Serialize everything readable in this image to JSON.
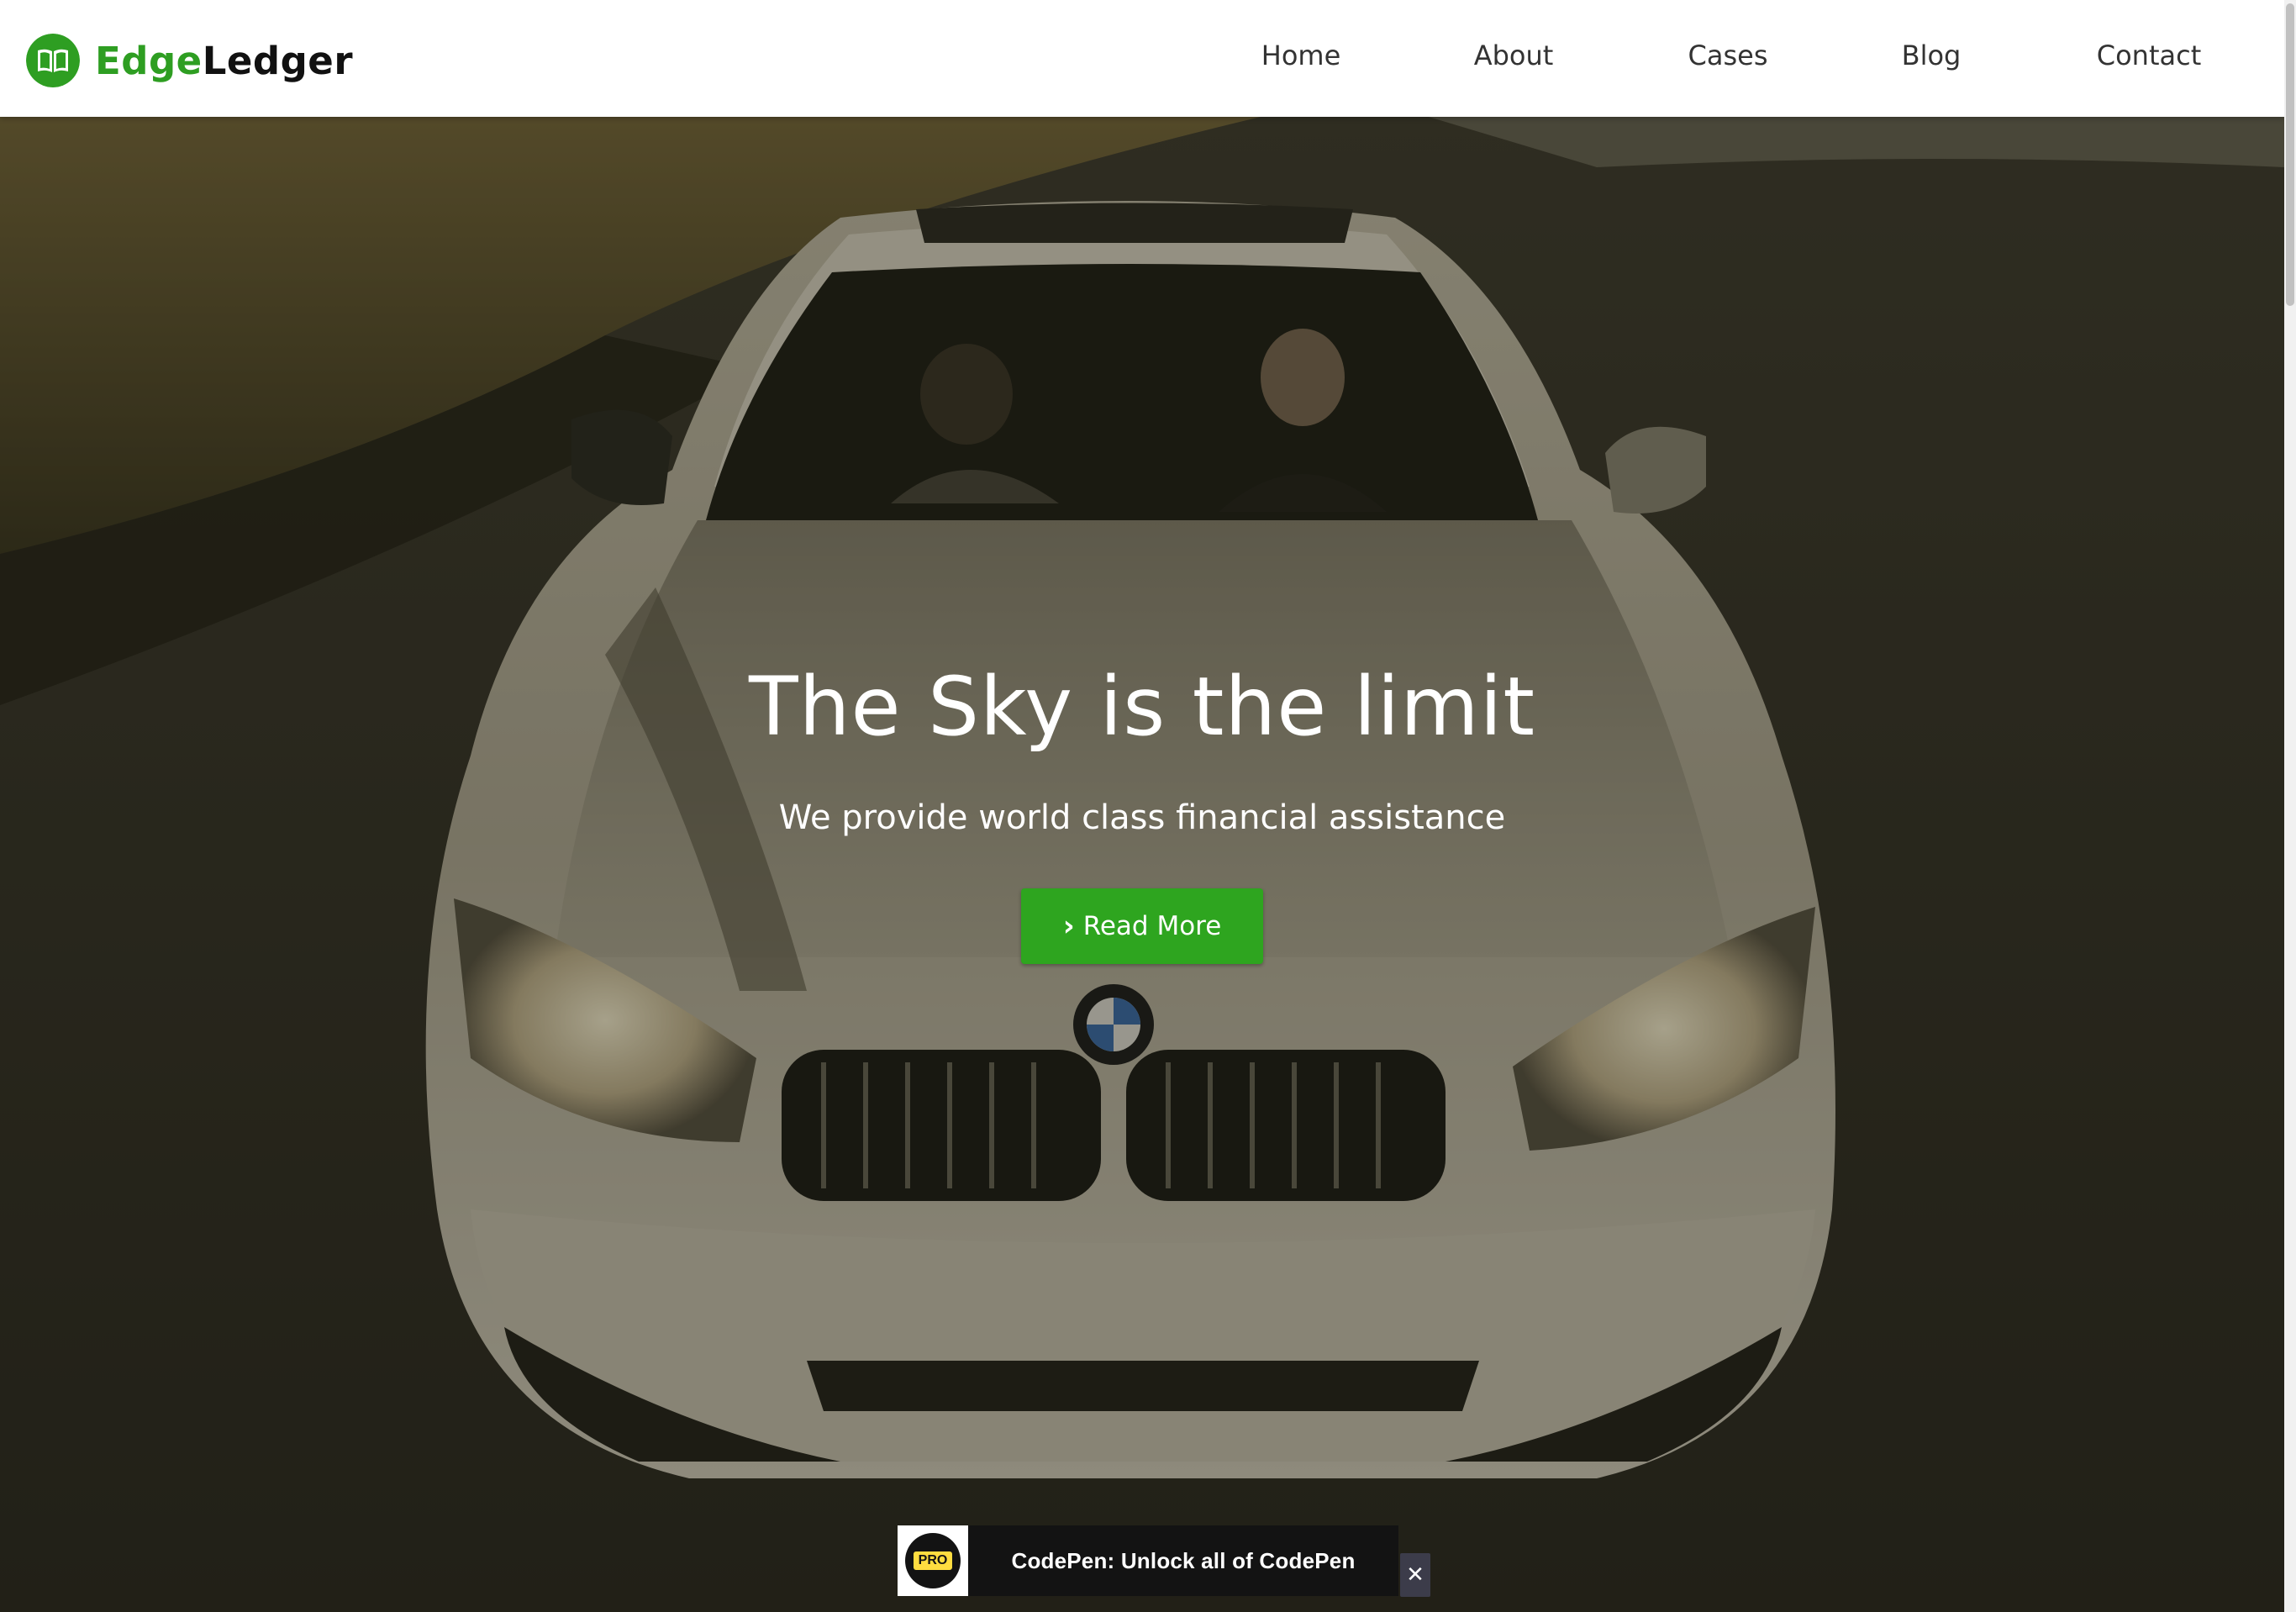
{
  "brand": {
    "name_part_1": "Edge",
    "name_part_2": "Ledger",
    "logo_icon": "book-icon",
    "primary_color": "#2e9e22"
  },
  "nav": {
    "items": [
      {
        "label": "Home"
      },
      {
        "label": "About"
      },
      {
        "label": "Cases"
      },
      {
        "label": "Blog"
      },
      {
        "label": "Contact"
      }
    ]
  },
  "hero": {
    "title": "The Sky is the limit",
    "subtitle": "We provide world class financial assistance",
    "cta_label": "Read More",
    "cta_icon": "chevron-right-icon",
    "cta_color": "#2ea51f",
    "background_image": "car-on-road-photo"
  },
  "codepen_banner": {
    "badge_label": "PRO",
    "text": "CodePen: Unlock all of CodePen",
    "close_glyph": "✕",
    "badge_color": "#ffdd40"
  }
}
